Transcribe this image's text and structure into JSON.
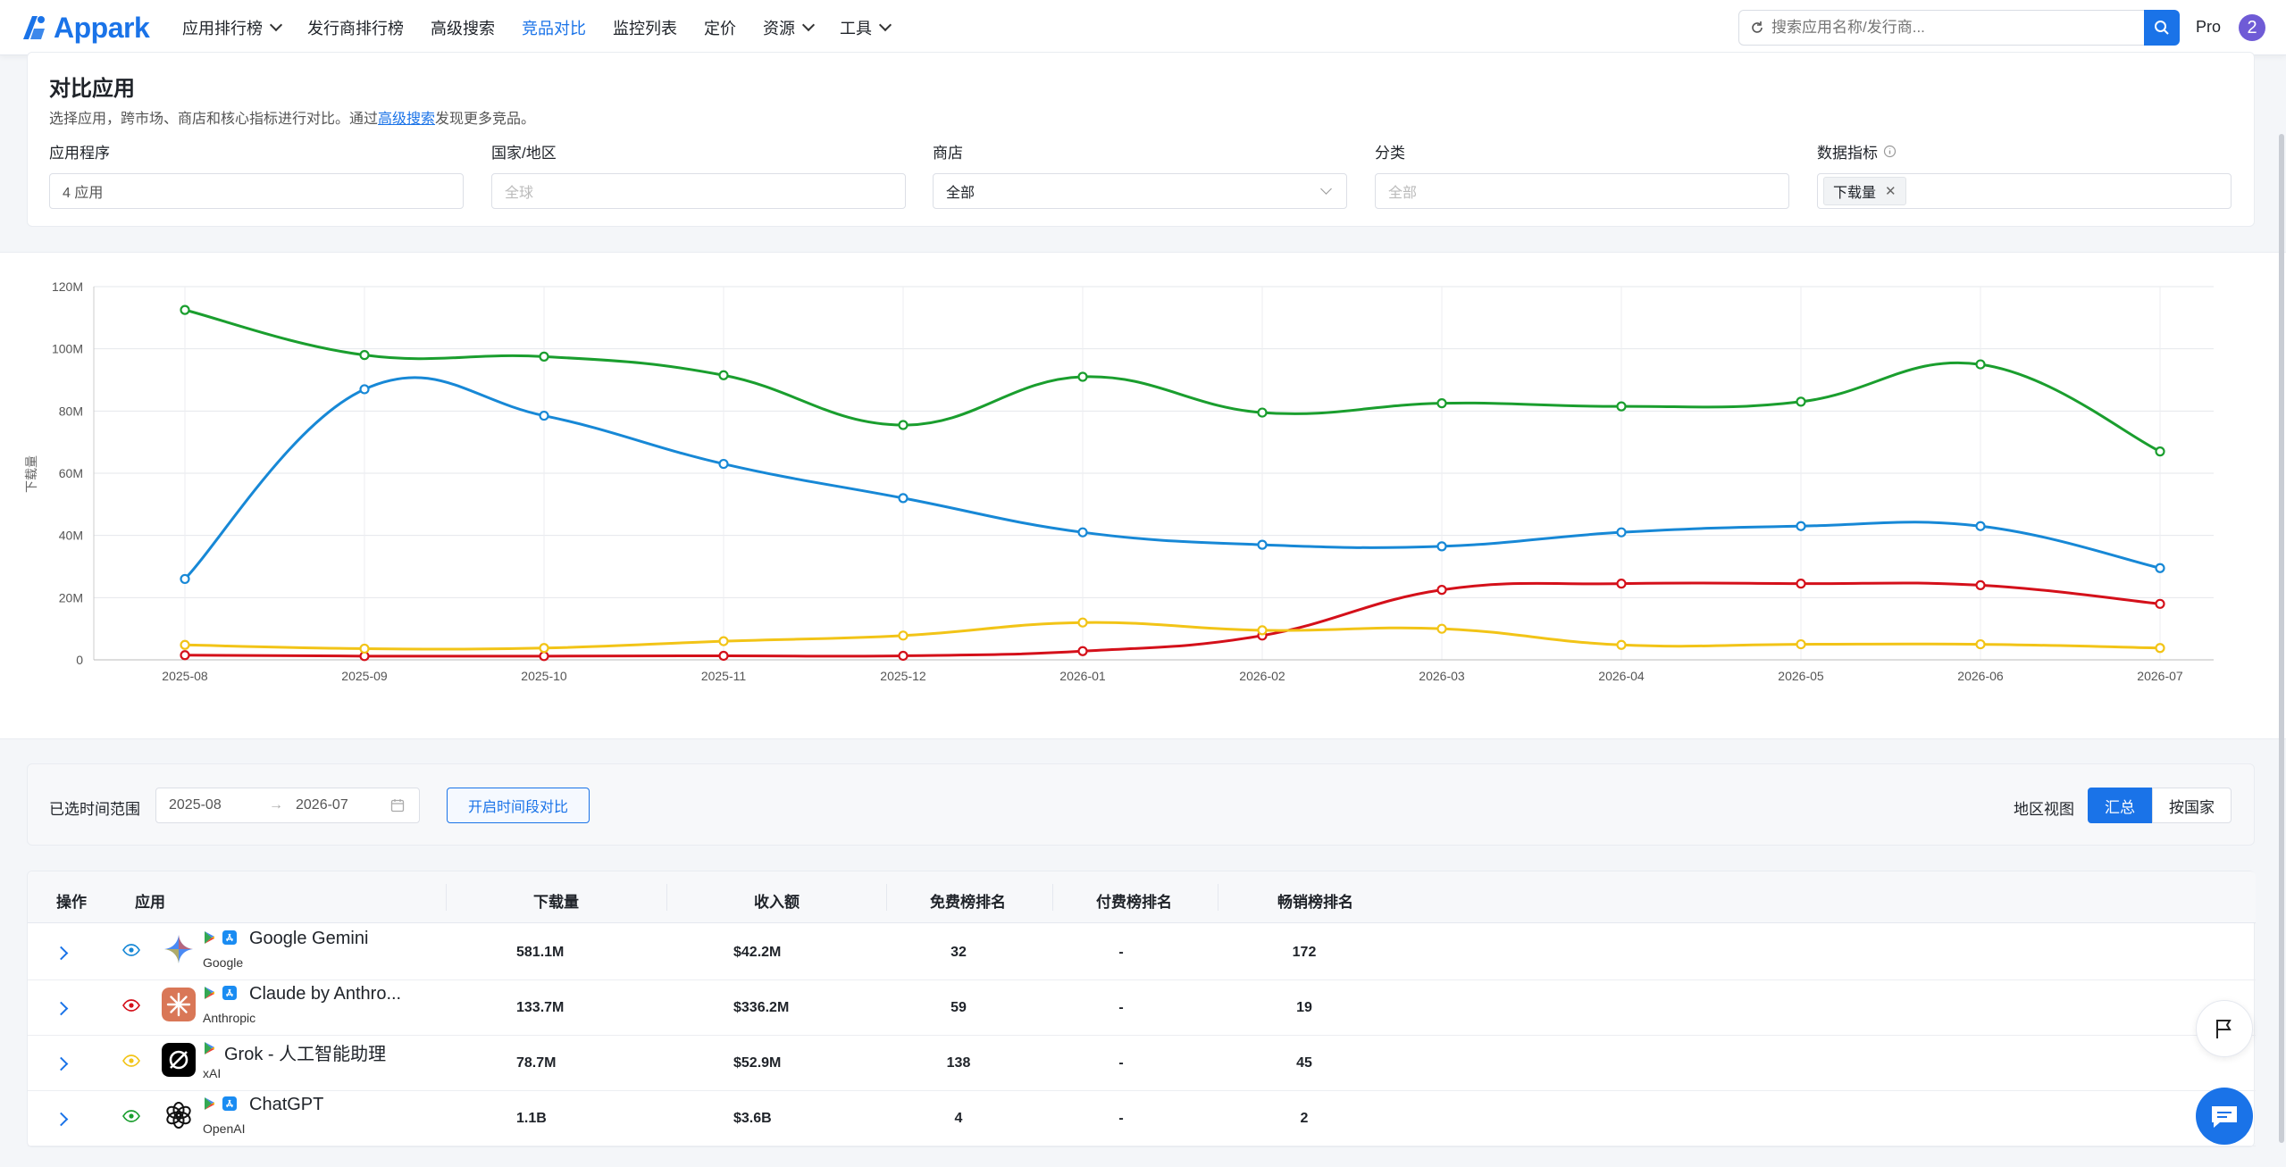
{
  "brand": {
    "name": "Appark",
    "color": "#1a73e8"
  },
  "nav": [
    {
      "label": "应用排行榜",
      "dropdown": true,
      "active": false
    },
    {
      "label": "发行商排行榜",
      "dropdown": false,
      "active": false
    },
    {
      "label": "高级搜索",
      "dropdown": false,
      "active": false
    },
    {
      "label": "竞品对比",
      "dropdown": false,
      "active": true
    },
    {
      "label": "监控列表",
      "dropdown": false,
      "active": false
    },
    {
      "label": "定价",
      "dropdown": false,
      "active": false
    },
    {
      "label": "资源",
      "dropdown": true,
      "active": false
    },
    {
      "label": "工具",
      "dropdown": true,
      "active": false
    }
  ],
  "search": {
    "placeholder": "搜索应用名称/发行商..."
  },
  "user": {
    "plan": "Pro",
    "avatar": "2"
  },
  "page": {
    "title": "对比应用",
    "subtitle_before": "选择应用，跨市场、商店和核心指标进行对比。通过",
    "subtitle_link": "高级搜索",
    "subtitle_after": "发现更多竞品。"
  },
  "filters": {
    "apps": {
      "label": "应用程序",
      "value": "4 应用"
    },
    "region": {
      "label": "国家/地区",
      "placeholder": "全球"
    },
    "store": {
      "label": "商店",
      "value": "全部"
    },
    "category": {
      "label": "分类",
      "placeholder": "全部"
    },
    "metric": {
      "label": "数据指标",
      "tag": "下载量"
    }
  },
  "chart_data": {
    "type": "line",
    "ylabel": "下载量",
    "ylim": [
      0,
      120
    ],
    "yticks": [
      "0",
      "20M",
      "40M",
      "60M",
      "80M",
      "100M",
      "120M"
    ],
    "ytick_values": [
      0,
      20,
      40,
      60,
      80,
      100,
      120
    ],
    "categories": [
      "2025-08",
      "2025-09",
      "2025-10",
      "2025-11",
      "2025-12",
      "2026-01",
      "2026-02",
      "2026-03",
      "2026-04",
      "2026-05",
      "2026-06",
      "2026-07"
    ],
    "grid": true,
    "series": [
      {
        "color": "#1a9e2e",
        "values": [
          112.5,
          98,
          97.5,
          91.5,
          75.5,
          91,
          79.5,
          82.5,
          81.5,
          83,
          95,
          67
        ]
      },
      {
        "color": "#1788d6",
        "values": [
          26,
          87,
          78.5,
          63,
          52,
          41,
          37,
          36.5,
          41,
          43,
          43,
          29.5
        ]
      },
      {
        "color": "#d4101a",
        "values": [
          1.5,
          1.2,
          1.2,
          1.3,
          1.3,
          2.8,
          7.8,
          22.5,
          24.5,
          24.5,
          24,
          18
        ]
      },
      {
        "color": "#f2c417",
        "values": [
          4.8,
          3.6,
          3.8,
          6,
          7.8,
          12,
          9.5,
          10,
          4.8,
          5,
          5,
          3.8
        ]
      }
    ]
  },
  "range": {
    "label": "已选时间范围",
    "start": "2025-08",
    "end": "2026-07",
    "compare_button": "开启时间段对比",
    "region_view_label": "地区视图",
    "seg_on": "汇总",
    "seg_off": "按国家"
  },
  "table": {
    "headers": {
      "op": "操作",
      "app": "应用",
      "downloads": "下载量",
      "revenue": "收入额",
      "free": "免费榜排名",
      "paid": "付费榜排名",
      "grossing": "畅销榜排名"
    },
    "rows": [
      {
        "name": "Google Gemini",
        "publisher": "Google",
        "downloads": "581.1M",
        "revenue": "$42.2M",
        "free": "32",
        "paid": "-",
        "grossing": "172",
        "eye": "#1788d6",
        "icon": "gemini",
        "stores": true
      },
      {
        "name": "Claude by Anthro...",
        "publisher": "Anthropic",
        "downloads": "133.7M",
        "revenue": "$336.2M",
        "free": "59",
        "paid": "-",
        "grossing": "19",
        "eye": "#d4101a",
        "icon": "claude",
        "stores": true
      },
      {
        "name": "Grok - 人工智能助理",
        "publisher": "xAI",
        "downloads": "78.7M",
        "revenue": "$52.9M",
        "free": "138",
        "paid": "-",
        "grossing": "45",
        "eye": "#f2c417",
        "icon": "grok",
        "stores": false
      },
      {
        "name": "ChatGPT",
        "publisher": "OpenAI",
        "downloads": "1.1B",
        "revenue": "$3.6B",
        "free": "4",
        "paid": "-",
        "grossing": "2",
        "eye": "#1a9e2e",
        "icon": "chatgpt",
        "stores": true
      }
    ]
  }
}
